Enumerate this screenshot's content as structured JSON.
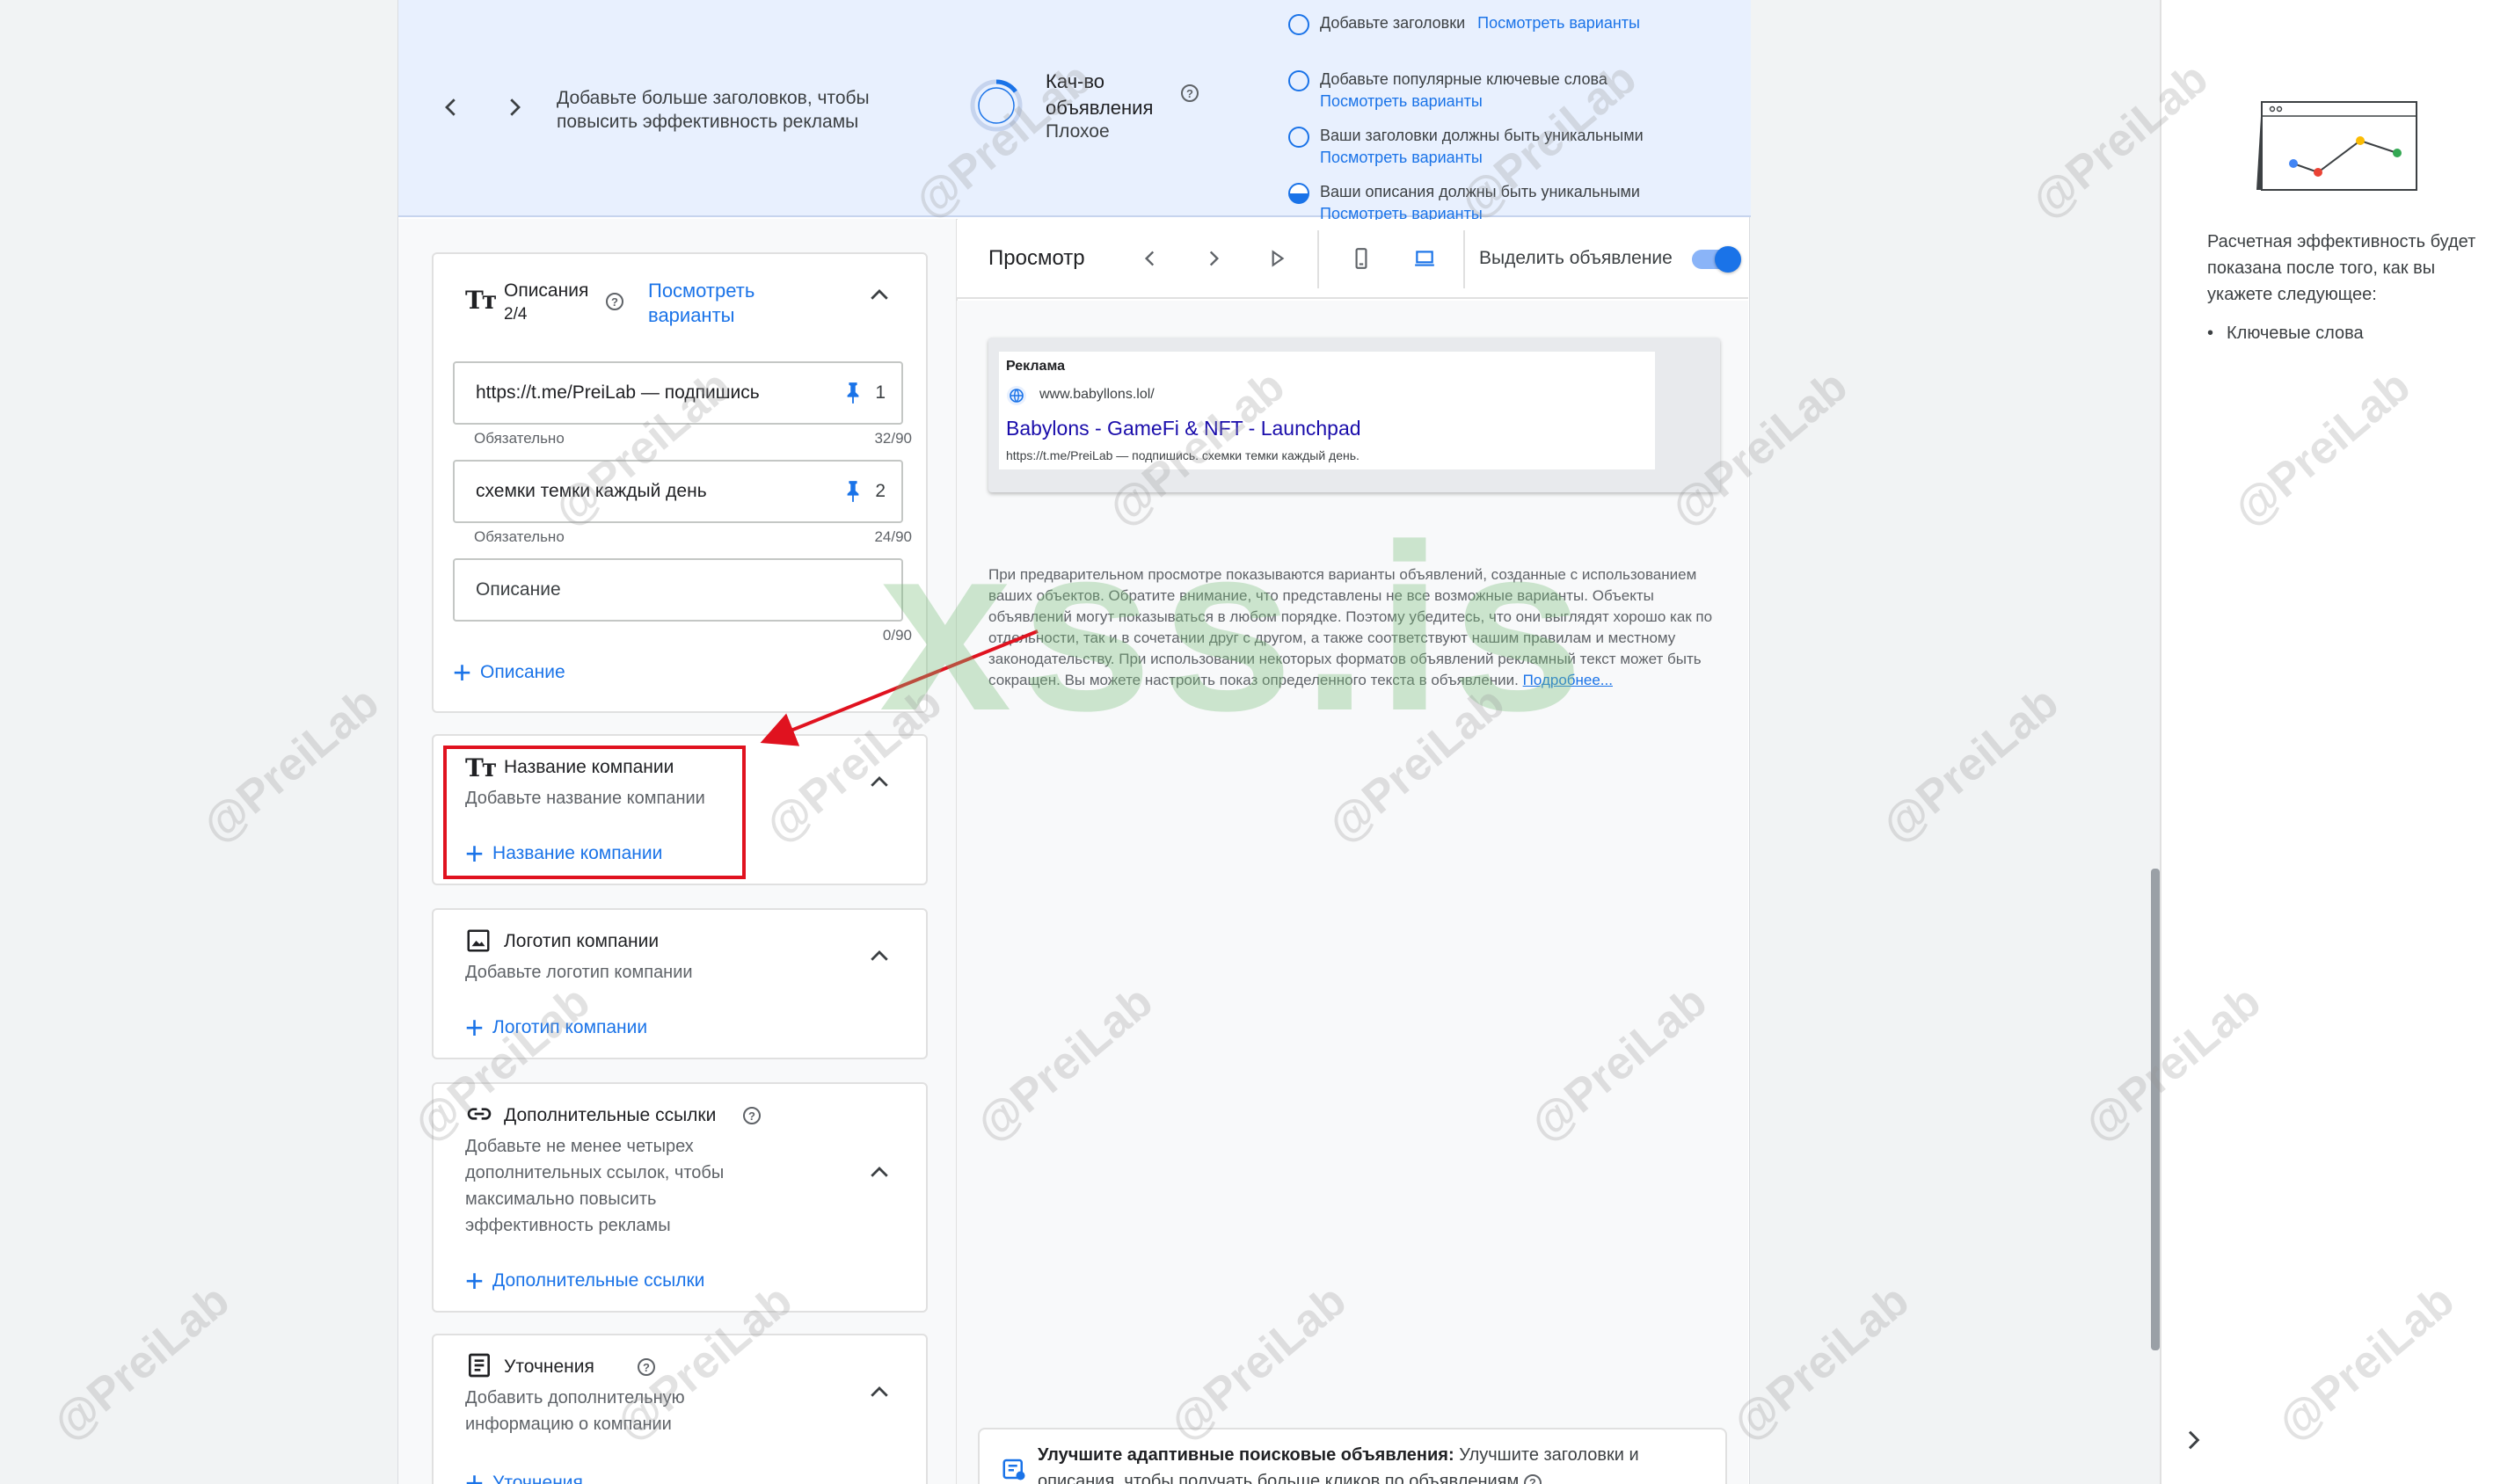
{
  "banner": {
    "message": "Добавьте больше заголовков, чтобы повысить эффективность рекламы",
    "quality_label": "Кач-во объявления",
    "quality_value": "Плохое",
    "quality_progress": 0.15,
    "checklist": [
      {
        "text": "Добавьте заголовки",
        "link": "Посмотреть варианты",
        "state": "empty"
      },
      {
        "text": "Добавьте популярные ключевые слова",
        "link": "Посмотреть варианты",
        "state": "empty"
      },
      {
        "text": "Ваши заголовки должны быть уникальными",
        "link": "Посмотреть варианты",
        "state": "empty"
      },
      {
        "text": "Ваши описания должны быть уникальными",
        "link": "Посмотреть варианты",
        "state": "half"
      }
    ]
  },
  "descriptions": {
    "title": "Описания",
    "count": "2/4",
    "view_link": "Посмотреть варианты",
    "fields": [
      {
        "value": "https://t.me/PreiLab — подпишись",
        "pin_number": "1",
        "hint": "Обязательно",
        "counter": "32/90"
      },
      {
        "value": "схемки темки каждый день",
        "pin_number": "2",
        "hint": "Обязательно",
        "counter": "24/90"
      },
      {
        "placeholder": "Описание",
        "counter": "0/90"
      }
    ],
    "add_label": "Описание"
  },
  "company_name": {
    "title": "Название компании",
    "subtitle": "Добавьте название компании",
    "add_label": "Название компании"
  },
  "company_logo": {
    "title": "Логотип компании",
    "subtitle": "Добавьте логотип компании",
    "add_label": "Логотип компании"
  },
  "sitelinks": {
    "title": "Дополнительные ссылки",
    "subtitle": "Добавьте не менее четырех дополнительных ссылок, чтобы максимально повысить эффективность рекламы",
    "add_label": "Дополнительные ссылки"
  },
  "callouts": {
    "title": "Уточнения",
    "subtitle": "Добавить дополнительную информацию о компании",
    "add_label": "Уточнения"
  },
  "preview": {
    "title": "Просмотр",
    "highlight_label": "Выделить объявление",
    "highlight_on": true,
    "ad": {
      "label": "Реклама",
      "domain": "www.babyllons.lol/",
      "headline": "Babylons - GameFi & NFT - Launchpad",
      "description": "https://t.me/PreiLab — подпишись. схемки темки каждый день."
    },
    "note": "При предварительном просмотре показываются варианты объявлений, созданные с использованием ваших объектов. Обратите внимание, что представлены не все возможные варианты. Объекты объявлений могут показываться в любом порядке. Поэтому убедитесь, что они выглядят хорошо как по отдельности, так и в сочетании друг с другом, а также соответствуют нашим правилам и местному законодательству. При использовании некоторых форматов объявлений рекламный текст может быть сокращен. Вы можете настроить показ определенного текста в объявлении.",
    "note_link": "Подробнее...",
    "tip_bold": "Улучшите адаптивные поисковые объявления:",
    "tip_text": "Улучшите заголовки и описания, чтобы получать больше кликов по объявлениям"
  },
  "right_panel": {
    "text": "Расчетная эффективность будет показана после того, как вы укажете следующее:",
    "items": [
      "Ключевые слова"
    ]
  },
  "watermarks": {
    "handle": "@PreiLab",
    "big": "xss.is"
  },
  "colors": {
    "accent": "#1a73e8",
    "highlight_red": "#e0121f",
    "banner_bg": "#e8f0fe",
    "ad_headline": "#1a0dab"
  }
}
